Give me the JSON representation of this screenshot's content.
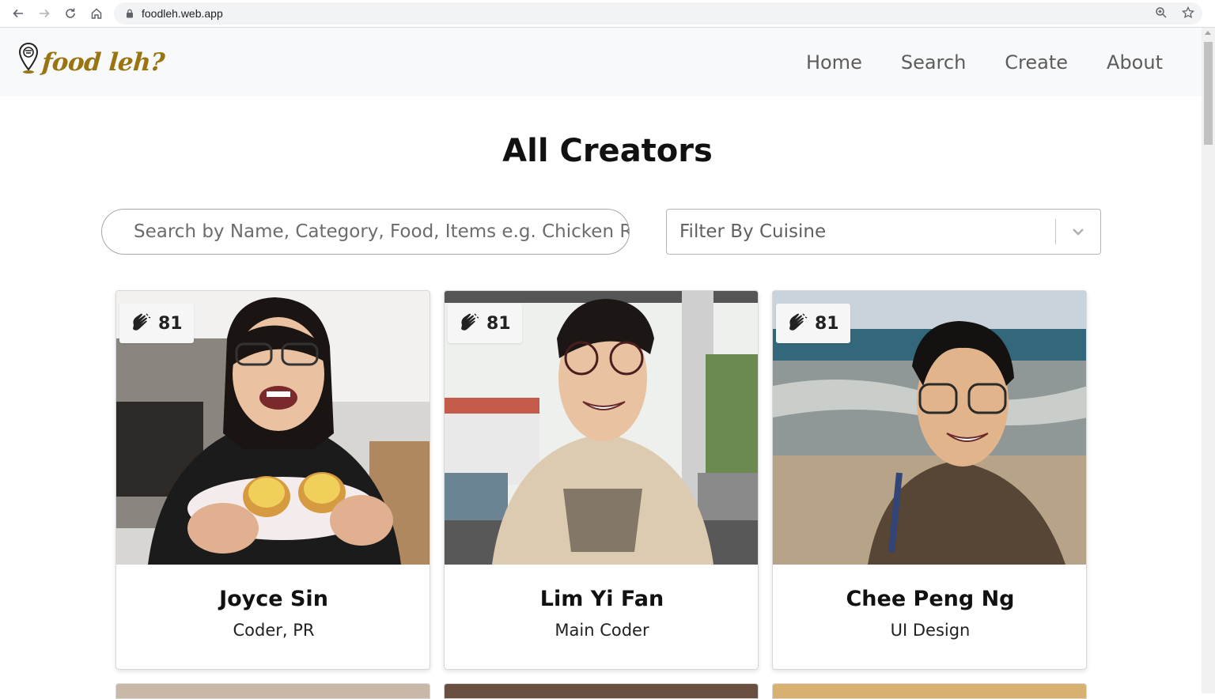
{
  "browser": {
    "url": "foodleh.web.app"
  },
  "site": {
    "logo_text": "food leh?",
    "nav": [
      "Home",
      "Search",
      "Create",
      "About"
    ]
  },
  "main": {
    "title": "All Creators",
    "search_placeholder": "Search by Name, Category, Food, Items e.g. Chicken Rice",
    "filter_placeholder": "Filter By Cuisine"
  },
  "creators": [
    {
      "name": "Joyce Sin",
      "role": "Coder, PR",
      "claps": "81"
    },
    {
      "name": "Lim Yi Fan",
      "role": "Main Coder",
      "claps": "81"
    },
    {
      "name": "Chee Peng Ng",
      "role": "UI Design",
      "claps": "81"
    }
  ],
  "colors": {
    "brand": "#9a7410",
    "header_bg": "#f8f9fa"
  }
}
